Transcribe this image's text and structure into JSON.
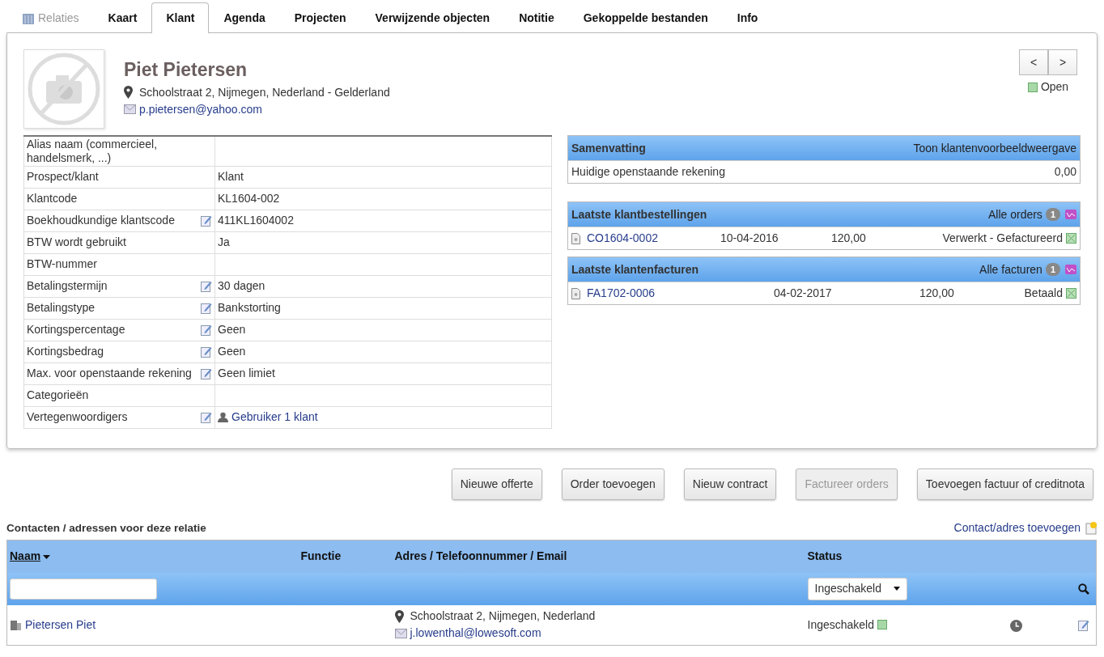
{
  "tabs": [
    {
      "label": "Relaties",
      "kind": "module",
      "selected": false
    },
    {
      "label": "Kaart",
      "kind": "tab",
      "selected": false
    },
    {
      "label": "Klant",
      "kind": "tab",
      "selected": true
    },
    {
      "label": "Agenda",
      "kind": "tab",
      "selected": false
    },
    {
      "label": "Projecten",
      "kind": "tab",
      "selected": false
    },
    {
      "label": "Verwijzende objecten",
      "kind": "tab",
      "selected": false
    },
    {
      "label": "Notitie",
      "kind": "tab",
      "selected": false
    },
    {
      "label": "Gekoppelde bestanden",
      "kind": "tab",
      "selected": false
    },
    {
      "label": "Info",
      "kind": "tab",
      "selected": false
    }
  ],
  "profile": {
    "name": "Piet Pietersen",
    "address": "Schoolstraat 2, Nijmegen, Nederland - Gelderland",
    "email": "p.pietersen@yahoo.com"
  },
  "pager": {
    "prev": "<",
    "next": ">",
    "status": "Open"
  },
  "fields": [
    {
      "label": "Alias naam (commercieel, handelsmerk, ...)",
      "editable": false,
      "kind": "text"
    },
    {
      "label": "Prospect/klant",
      "value": "Klant",
      "editable": false,
      "kind": "text"
    },
    {
      "label": "Klantcode",
      "value": "KL1604-002",
      "editable": false,
      "kind": "text"
    },
    {
      "label": "Boekhoudkundige klantscode",
      "value": "411KL1604002",
      "editable": true,
      "kind": "text"
    },
    {
      "label": "BTW wordt gebruikt",
      "value": "Ja",
      "editable": false,
      "kind": "text"
    },
    {
      "label": "BTW-nummer",
      "editable": false,
      "kind": "text"
    },
    {
      "label": "Betalingstermijn",
      "value": "30 dagen",
      "editable": true,
      "kind": "text"
    },
    {
      "label": "Betalingstype",
      "value": "Bankstorting",
      "editable": true,
      "kind": "text"
    },
    {
      "label": "Kortingspercentage",
      "value": "Geen",
      "editable": true,
      "kind": "text"
    },
    {
      "label": "Kortingsbedrag",
      "value": "Geen",
      "editable": true,
      "kind": "text"
    },
    {
      "label": "Max. voor openstaande rekening",
      "value": "Geen limiet",
      "editable": true,
      "kind": "text"
    },
    {
      "label": "Categorieën",
      "editable": false,
      "kind": "text"
    },
    {
      "label": "Vertegenwoordigers",
      "value": "Gebruiker 1 klant",
      "editable": true,
      "kind": "user"
    }
  ],
  "summary": {
    "title": "Samenvatting",
    "link": "Toon klantenvoorbeeldweergave",
    "rows": [
      {
        "label": "Huidige openstaande rekening",
        "value": "0,00"
      }
    ]
  },
  "orders": {
    "title": "Laatste klantbestellingen",
    "link": "Alle orders",
    "count": "1",
    "rows": [
      {
        "ref": "CO1604-0002",
        "date": "10-04-2016",
        "amount": "120,00",
        "status": "Verwerkt - Gefactureerd"
      }
    ]
  },
  "invoices": {
    "title": "Laatste klantenfacturen",
    "link": "Alle facturen",
    "count": "1",
    "rows": [
      {
        "ref": "FA1702-0006",
        "date": "04-02-2017",
        "amount": "120,00",
        "status": "Betaald"
      }
    ]
  },
  "buttons": [
    {
      "label": "Nieuwe offerte",
      "disabled": false
    },
    {
      "label": "Order toevoegen",
      "disabled": false
    },
    {
      "label": "Nieuw contract",
      "disabled": false
    },
    {
      "label": "Factureer orders",
      "disabled": true
    },
    {
      "label": "Toevoegen factuur of creditnota",
      "disabled": false
    }
  ],
  "contacts": {
    "title": "Contacten / adressen voor deze relatie",
    "add_link": "Contact/adres toevoegen",
    "columns": [
      {
        "label": "Naam",
        "sorted": true
      },
      {
        "label": "Functie",
        "sorted": false
      },
      {
        "label": "Adres / Telefoonnummer / Email",
        "sorted": false
      },
      {
        "label": "Status",
        "sorted": false
      }
    ],
    "status_filter": "Ingeschakeld",
    "rows": [
      {
        "name": "Pietersen Piet",
        "address": "Schoolstraat 2, Nijmegen, Nederland",
        "email": "j.lowenthal@lowesoft.com",
        "status": "Ingeschakeld"
      }
    ]
  }
}
